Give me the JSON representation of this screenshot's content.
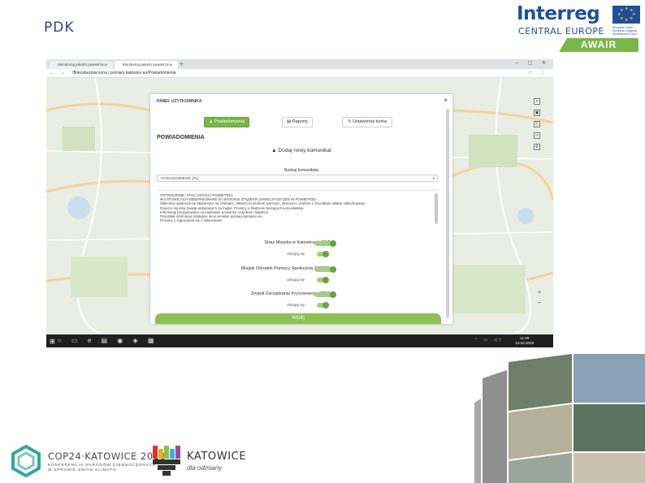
{
  "slide": {
    "title": "PDK"
  },
  "logos": {
    "interreg": {
      "name": "Interreg",
      "program": "CENTRAL EUROPE",
      "project": "AWAIR",
      "eu_text": "European Union European Regional Development Fund"
    },
    "cop": {
      "name": "COP24·KATOWICE 2018",
      "sub_line_1": "KONFERENCJA NARODÓW ZJEDNOCZONYCH",
      "sub_line_2": "W SPRAWIE ZMIAN KLIMATU"
    },
    "katowice": {
      "name": "KATOWICE",
      "tagline": "dla odmiany"
    }
  },
  "browser": {
    "tabs": [
      {
        "label": "Monitoring jakości powietrza w"
      },
      {
        "label": "Monitoring jakości powietrza w"
      }
    ],
    "new_tab": "+",
    "url": "Niezabezpieczona | pomiary.katowice.eu/Powiadomienia"
  },
  "modal": {
    "title": "PANEL UŻYTKOWNIKA",
    "close": "×",
    "tabs": [
      {
        "label": "Powiadomienia",
        "icon": "bell-icon",
        "active": true
      },
      {
        "label": "Raporty",
        "icon": "print-icon",
        "active": false
      },
      {
        "label": "Ustawienia konta",
        "icon": "wrench-icon",
        "active": false
      }
    ],
    "section_title": "POWIADOMIENIA",
    "add_link": "Dodaj nowy komunikat",
    "form_label": "Rodzaj komunikatu",
    "select_value": "POWIADOMIENIE [PL]",
    "message_lines": [
      "OSTRZEŻENIE: STAN JAKOŚCI POWIETRZA",
      "W KATOWICACH OBSERWOWANE SĄ WYSOKIE STĘŻENIA ZANIECZYSZCZEŃ W POWIETRZU.",
      "Zalecamy ograniczenie aktywności na zewnątrz, zwłaszcza osobom starszym, dzieciom i osobom z chorobami układu oddechowego.",
      "Dotyczy rejonów miasta wskazanych na mapie. Prosimy o śledzenie bieżących komunikatów.",
      "Informację przygotowano na podstawie pomiarów czujników miejskich.",
      "Pozostałe informacje dostępne są w serwisie pomiary.katowice.eu.",
      "Prosimy o zapoznanie się z zaleceniami."
    ],
    "organizations": [
      {
        "name": "Straż Miejska w Katowicach (SM)",
        "sub_label": "Zaloguj się",
        "enabled": true
      },
      {
        "name": "Miejski Ośrodek Pomocy Społecznej (MOPS)",
        "sub_label": "Zaloguj się",
        "enabled": true
      },
      {
        "name": "Zespół Zarządzania Kryzysowego (ZZK)",
        "sub_label": "Zaloguj się",
        "enabled": true
      }
    ],
    "send_button": "Wyślij"
  },
  "taskbar": {
    "time": "11:49",
    "date": "13.02.2019"
  },
  "colors": {
    "accent_green": "#7ab648",
    "toggle_green": "#a7cc85",
    "interreg_blue": "#1d4f9c",
    "slide_title": "#3a3f8f"
  }
}
